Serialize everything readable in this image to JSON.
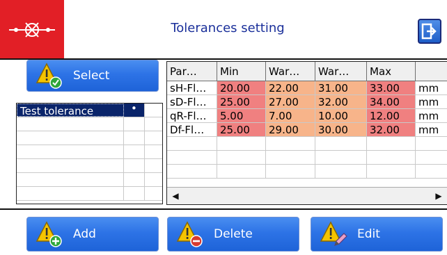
{
  "header": {
    "title": "Tolerances setting",
    "logo_icon": "gauge-logo-icon",
    "logo_color": "#e21f26",
    "exit_icon": "exit-icon"
  },
  "buttons": {
    "select": "Select",
    "add": "Add",
    "delete": "Delete",
    "edit": "Edit"
  },
  "tolerance_list": {
    "items": [
      {
        "name": "Test tolerance",
        "marker": "•",
        "selected": true
      }
    ]
  },
  "table": {
    "columns": [
      "Par…",
      "Min",
      "War…",
      "War…",
      "Max",
      ""
    ],
    "rows": [
      {
        "param": "sH-Fl…",
        "min": "20.00",
        "warn_low": "22.00",
        "warn_high": "31.00",
        "max": "33.00",
        "unit": "mm"
      },
      {
        "param": "sD-Fl…",
        "min": "25.00",
        "warn_low": "27.00",
        "warn_high": "32.00",
        "max": "34.00",
        "unit": "mm"
      },
      {
        "param": "qR-Fl…",
        "min": "5.00",
        "warn_low": "7.00",
        "warn_high": "10.00",
        "max": "12.00",
        "unit": "mm"
      },
      {
        "param": "Df-Fl…",
        "min": "25.00",
        "warn_low": "29.00",
        "warn_high": "30.00",
        "max": "32.00",
        "unit": "mm"
      }
    ],
    "colors": {
      "limit": "#f08080",
      "warning": "#f7b48a"
    }
  },
  "scrollbar": {
    "left_icon": "scroll-left-arrow-icon",
    "right_icon": "scroll-right-arrow-icon"
  }
}
